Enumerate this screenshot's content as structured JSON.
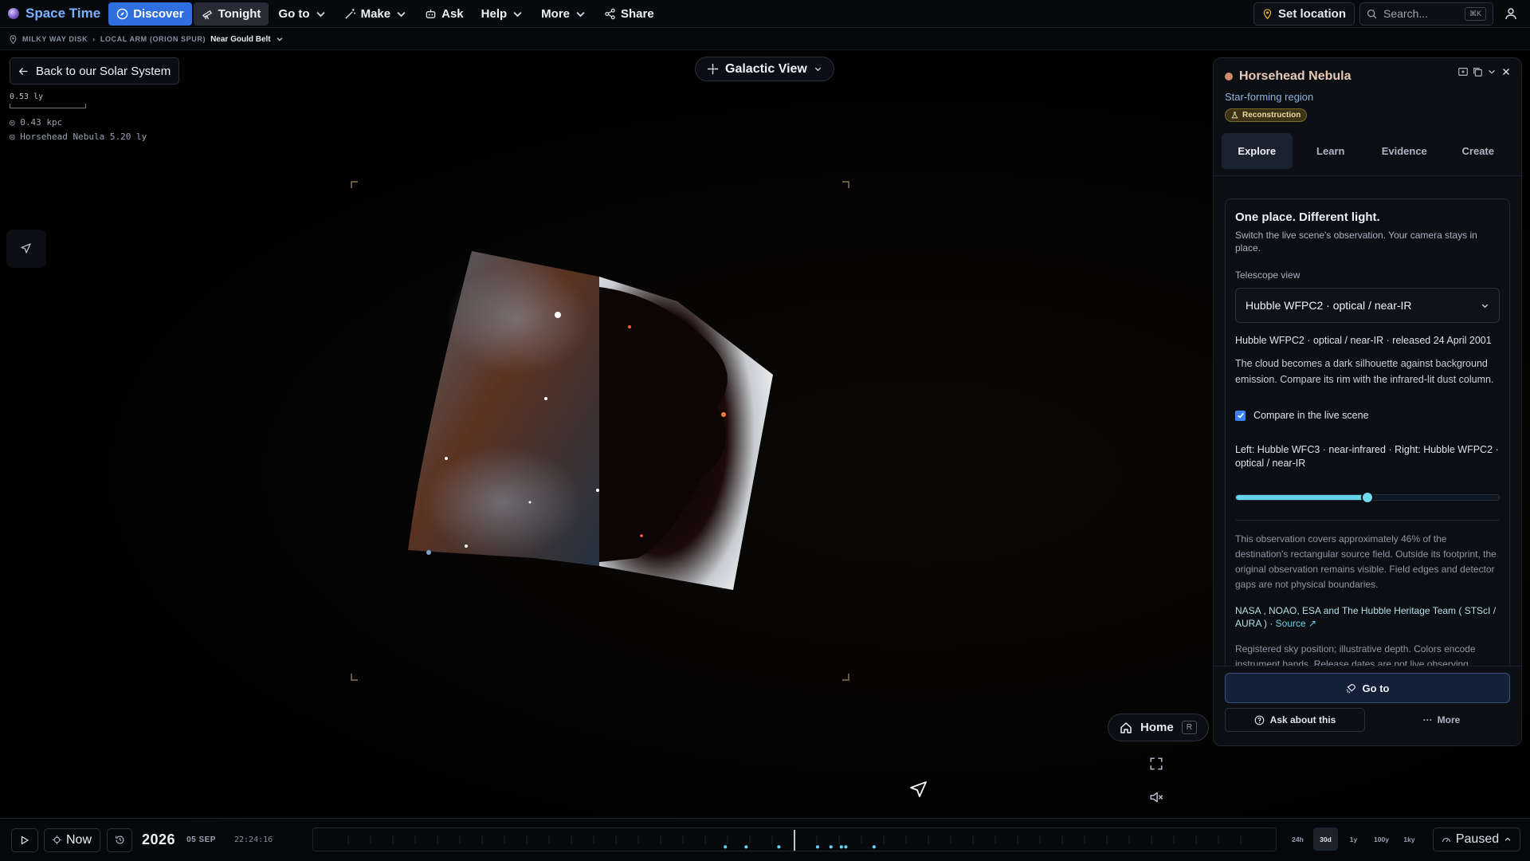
{
  "app": {
    "name": "Space Time"
  },
  "nav": {
    "discover": "Discover",
    "tonight": "Tonight",
    "goto": "Go to",
    "make": "Make",
    "ask": "Ask",
    "help": "Help",
    "more": "More",
    "share": "Share"
  },
  "top_right": {
    "set_location": "Set location",
    "search_placeholder": "Search...",
    "search_shortcut": "⌘K"
  },
  "breadcrumb": {
    "items": [
      "MILKY WAY DISK",
      "LOCAL ARM (ORION SPUR)"
    ],
    "separator": "›",
    "current": "Near Gould Belt"
  },
  "back_button": "Back to our Solar System",
  "scale": {
    "label": "0.53 ly",
    "distance": "0.43 kpc",
    "target": "Horsehead Nebula 5.20 ly"
  },
  "view_mode": "Galactic View",
  "home": {
    "label": "Home",
    "shortcut": "R"
  },
  "panel": {
    "title": "Horsehead Nebula",
    "subtitle": "Star-forming region",
    "badge": "Reconstruction",
    "tabs": [
      "Explore",
      "Learn",
      "Evidence",
      "Create"
    ],
    "active_tab": "Explore",
    "card": {
      "heading": "One place. Different light.",
      "description": "Switch the live scene's observation. Your camera stays in place.",
      "telescope_label": "Telescope view",
      "telescope_value": "Hubble WFPC2 · optical / near-IR",
      "observation_info": "Hubble WFPC2 · optical / near-IR · released 24 April 2001",
      "observation_text": "The cloud becomes a dark silhouette against background emission. Compare its rim with the infrared-lit dust column.",
      "compare_label": "Compare in the live scene",
      "compare_checked": true,
      "compare_text": "Left: Hubble WFC3 · near-infrared · Right: Hubble WFPC2 · optical / near-IR",
      "slider_value": 0.5,
      "coverage_note": "This observation covers approximately 46% of the destination's rectangular source field. Outside its footprint, the original observation remains visible. Field edges and detector gaps are not physical boundaries.",
      "credit": "NASA , NOAO, ESA and The Hubble Heritage Team ( STScI / AURA ) · ",
      "source_link": "Source ↗",
      "disclaimer": "Registered sky position; illustrative depth. Colors encode instrument bands. Release dates are not live observing"
    },
    "goto_button": "Go to",
    "ask_button": "Ask about this",
    "more_button": "More"
  },
  "timeline": {
    "now_label": "Now",
    "year": "2026",
    "date": "05 SEP",
    "time": "22:24:16",
    "ranges": [
      "24h",
      "30d",
      "1y",
      "100y",
      "1ky"
    ],
    "active_range": "30d",
    "status": "Paused"
  }
}
